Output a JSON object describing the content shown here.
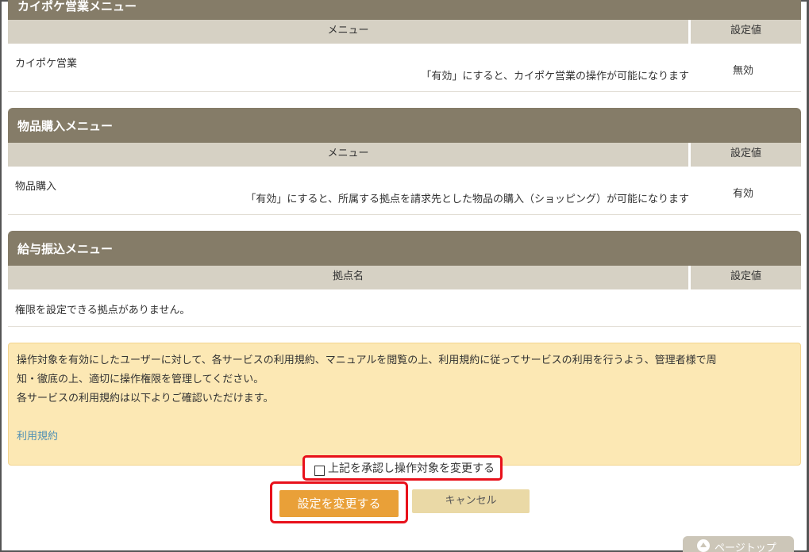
{
  "sections": [
    {
      "title": "カイポケ営業メニュー",
      "col1": "メニュー",
      "col2": "設定値",
      "row": {
        "name": "カイポケ営業",
        "desc": "「有効」にすると、カイポケ営業の操作が可能になります",
        "value": "無効"
      }
    },
    {
      "title": "物品購入メニュー",
      "col1": "メニュー",
      "col2": "設定値",
      "row": {
        "name": "物品購入",
        "desc": "「有効」にすると、所属する拠点を請求先とした物品の購入（ショッピング）が可能になります",
        "value": "有効"
      }
    },
    {
      "title": "給与振込メニュー",
      "col1": "拠点名",
      "col2": "設定値",
      "row": {
        "name": "権限を設定できる拠点がありません。"
      }
    }
  ],
  "notice": {
    "line1": "操作対象を有効にしたユーザーに対して、各サービスの利用規約、マニュアルを閲覧の上、利用規約に従ってサービスの利用を行うよう、管理者様で周",
    "line2": "知・徹底の上、適切に操作権限を管理してください。",
    "line3": "各サービスの利用規約は以下よりご確認いただけます。",
    "link": "利用規約"
  },
  "confirm": {
    "label": "上記を承認し操作対象を変更する"
  },
  "buttons": {
    "submit": "設定を変更する",
    "cancel": "キャンセル"
  },
  "pagetop": "ページトップ"
}
